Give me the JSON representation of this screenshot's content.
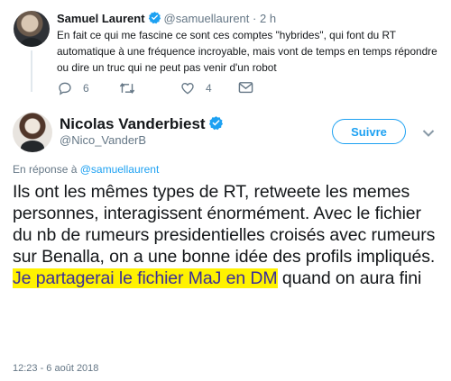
{
  "parent_tweet": {
    "author_name": "Samuel Laurent",
    "handle": "@samuellaurent",
    "separator": "·",
    "time": "2 h",
    "text": "En fait ce qui me fascine ce sont ces comptes \"hybrides\", qui font du RT automatique à une fréquence incroyable, mais vont de temps en temps répondre ou dire un truc qui ne peut pas venir d'un robot",
    "reply_count": "6",
    "retweet_count": "",
    "like_count": "4"
  },
  "main_tweet": {
    "author_name": "Nicolas Vanderbiest",
    "handle": "@Nico_VanderB",
    "follow_label": "Suivre",
    "reply_prefix": "En réponse à",
    "reply_mention": "@samuellaurent",
    "text_plain": "Ils ont les mêmes types de RT, retweete les memes personnes, interagissent énormément. Avec le fichier du nb de rumeurs presidentielles croisés avec rumeurs sur Benalla, on a une bonne idée des profils impliqués.",
    "text_highlight": "Je partagerai le fichier MaJ en DM",
    "text_after": " quand on aura fini",
    "timestamp": "12:23 - 6 août 2018"
  },
  "colors": {
    "accent": "#1da1f2",
    "muted": "#657786",
    "highlight": "#fff200",
    "highlight_text": "#3b2e99"
  },
  "icons": [
    "verified-badge-icon",
    "reply-icon",
    "retweet-icon",
    "like-icon",
    "message-icon",
    "chevron-down-icon"
  ]
}
